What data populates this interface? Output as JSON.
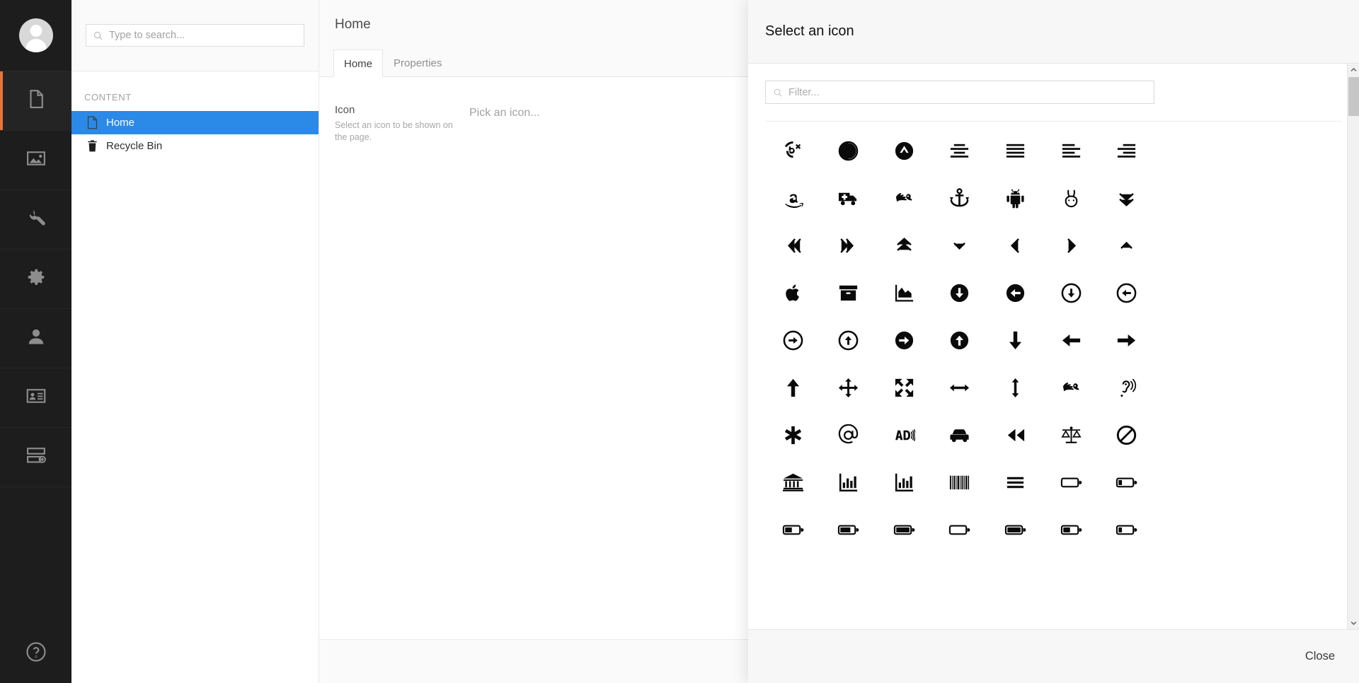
{
  "rail": {
    "avatar_name": "user-avatar",
    "items": [
      {
        "name": "content",
        "icon": "document-icon",
        "active": true
      },
      {
        "name": "media",
        "icon": "image-icon",
        "active": false
      },
      {
        "name": "settings",
        "icon": "wrench-icon",
        "active": false
      },
      {
        "name": "packages",
        "icon": "gear-icon",
        "active": false
      },
      {
        "name": "users",
        "icon": "user-icon",
        "active": false
      },
      {
        "name": "members",
        "icon": "id-card-icon",
        "active": false
      },
      {
        "name": "forms",
        "icon": "server-add-icon",
        "active": false
      }
    ],
    "help_icon": "help-circle-icon"
  },
  "tree": {
    "search": {
      "placeholder": "Type to search...",
      "value": "",
      "icon": "search-icon"
    },
    "group_title": "CONTENT",
    "nodes": [
      {
        "label": "Home",
        "icon": "document-icon",
        "selected": true
      },
      {
        "label": "Recycle Bin",
        "icon": "trash-icon",
        "selected": false
      }
    ]
  },
  "editor": {
    "title": "Home",
    "tabs": [
      {
        "label": "Home",
        "active": true
      },
      {
        "label": "Properties",
        "active": false
      }
    ],
    "property": {
      "label": "Icon",
      "description": "Select an icon to be shown on the page.",
      "value": "Pick an icon..."
    }
  },
  "overlay": {
    "title": "Select an icon",
    "filter": {
      "placeholder": "Filter...",
      "value": "",
      "icon": "search-icon"
    },
    "close_label": "Close",
    "scrollbar": {
      "up_icon": "chevron-up-icon",
      "down_icon": "chevron-down-icon"
    },
    "icons": [
      "five-hundred-px-icon",
      "adjust-icon",
      "adn-icon",
      "align-center-icon",
      "align-justify-icon",
      "align-left-icon",
      "align-right-icon",
      "amazon-icon",
      "ambulance-icon",
      "american-sign-language-icon",
      "anchor-icon",
      "android-icon",
      "angellist-icon",
      "angle-double-down-icon",
      "angle-double-left-icon",
      "angle-double-right-icon",
      "angle-double-up-icon",
      "angle-down-icon",
      "angle-left-icon",
      "angle-right-icon",
      "angle-up-icon",
      "apple-icon",
      "archive-icon",
      "area-chart-icon",
      "arrow-circle-down-icon",
      "arrow-circle-left-icon",
      "arrow-circle-o-down-icon",
      "arrow-circle-o-left-icon",
      "arrow-circle-o-right-icon",
      "arrow-circle-o-up-icon",
      "arrow-circle-right-icon",
      "arrow-circle-up-icon",
      "arrow-down-icon",
      "arrow-left-icon",
      "arrow-right-icon",
      "arrow-up-icon",
      "arrows-icon",
      "arrows-alt-icon",
      "arrows-h-icon",
      "arrows-v-icon",
      "asl-interpreting-icon",
      "assistive-listening-systems-icon",
      "asterisk-icon",
      "at-icon",
      "audio-description-icon",
      "automobile-icon",
      "backward-icon",
      "balance-scale-icon",
      "ban-icon",
      "bank-icon",
      "bar-chart-icon",
      "bar-chart-o-icon",
      "barcode-icon",
      "bars-icon",
      "battery-empty-icon",
      "battery-quarter-icon",
      "battery-half-icon",
      "battery-three-quarters-icon",
      "battery-full-icon",
      "battery-0-icon",
      "battery-4-icon",
      "battery-2-icon",
      "battery-1-icon"
    ]
  },
  "colors": {
    "accent_blue": "#2b8ae8",
    "rail_bg": "#1d1d1d",
    "rail_active_bar": "#e8743b",
    "panel_gray": "#f7f7f7"
  }
}
